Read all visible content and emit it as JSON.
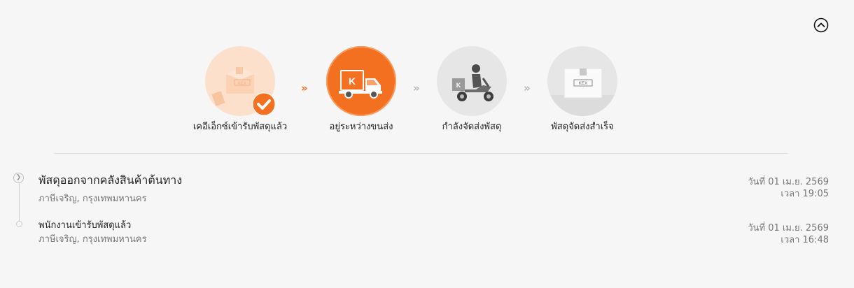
{
  "steps": [
    {
      "label": "เคอีเอ็กซ์เข้ารับพัสดุแล้ว",
      "state": "done",
      "icon": "box-icon"
    },
    {
      "label": "อยู่ระหว่างขนส่ง",
      "state": "current",
      "icon": "truck-icon"
    },
    {
      "label": "กำลังจัดส่งพัสดุ",
      "state": "pending",
      "icon": "scooter-courier-icon"
    },
    {
      "label": "พัสดุจัดส่งสำเร็จ",
      "state": "pending",
      "icon": "box-icon"
    }
  ],
  "step_arrow": "»",
  "brand_box_text": "KEX",
  "events": [
    {
      "title": "พัสดุออกจากคลังสินค้าต้นทาง",
      "location": "ภาษีเจริญ, กรุงเทพมหานคร",
      "date": "วันที่ 01 เม.ย. 2569",
      "time": "เวลา 19:05"
    },
    {
      "title": "พนักงานเข้ารับพัสดุแล้ว",
      "location": "ภาษีเจริญ, กรุงเทพมหานคร",
      "date": "วันที่ 01 เม.ย. 2569",
      "time": "เวลา 16:48"
    }
  ],
  "colors": {
    "accent": "#f37021",
    "accent_light": "#fde0cb",
    "inactive": "#e6e6e6"
  }
}
